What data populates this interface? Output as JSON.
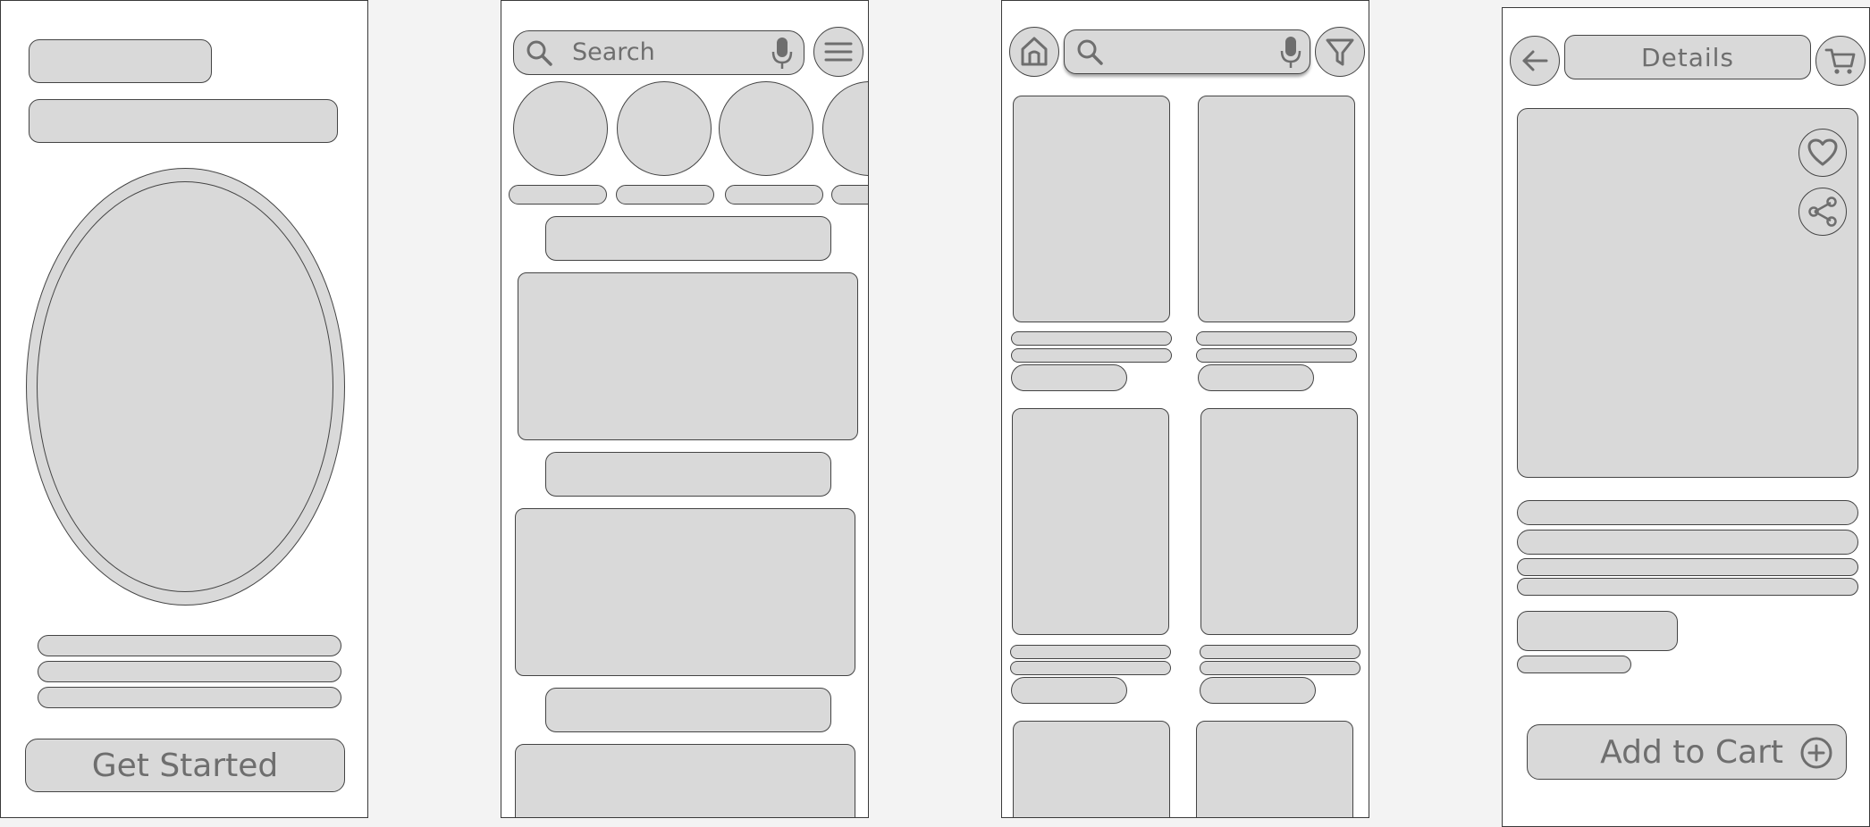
{
  "screens": {
    "onboarding": {
      "cta_label": "Get Started"
    },
    "home": {
      "search_placeholder": "Search"
    },
    "listing": {},
    "details": {
      "title": "Details",
      "cta_label": "Add to Cart"
    }
  },
  "icons": {
    "search": "search-icon",
    "mic": "microphone-icon",
    "menu": "hamburger-menu-icon",
    "home": "home-icon",
    "filter": "filter-icon",
    "back": "back-arrow-icon",
    "cart": "cart-icon",
    "heart": "heart-icon",
    "share": "share-icon",
    "plus": "plus-circle-icon"
  },
  "colors": {
    "background": "#f3f3f3",
    "screen": "#ffffff",
    "placeholder_fill": "#d9d9d9",
    "stroke": "#444444",
    "label": "#6e6e6e"
  }
}
